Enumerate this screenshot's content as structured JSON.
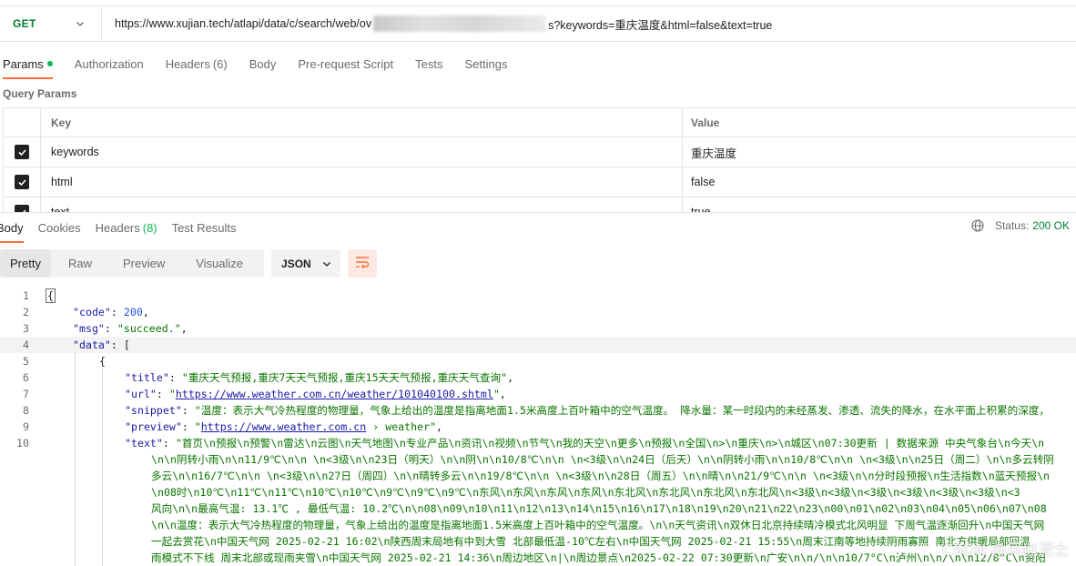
{
  "request": {
    "method": "GET",
    "url_prefix": "https://www.xujian.tech/atlapi/data/c/search/web/ov",
    "url_suffix": "s?keywords=重庆温度&html=false&text=true"
  },
  "request_tabs": [
    {
      "label": "Params",
      "count": "",
      "active": true
    },
    {
      "label": "Authorization",
      "count": ""
    },
    {
      "label": "Headers",
      "count": "(6)"
    },
    {
      "label": "Body",
      "count": ""
    },
    {
      "label": "Pre-request Script",
      "count": ""
    },
    {
      "label": "Tests",
      "count": ""
    },
    {
      "label": "Settings",
      "count": ""
    }
  ],
  "query_params": {
    "title": "Query Params",
    "header_key": "Key",
    "header_value": "Value",
    "rows": [
      {
        "key": "keywords",
        "value": "重庆温度",
        "checked": true
      },
      {
        "key": "html",
        "value": "false",
        "checked": true
      },
      {
        "key": "text",
        "value": "true",
        "checked": true
      }
    ]
  },
  "response_tabs": [
    {
      "label": "Body",
      "count": "",
      "active": true
    },
    {
      "label": "Cookies",
      "count": ""
    },
    {
      "label": "Headers",
      "count": "(8)"
    },
    {
      "label": "Test Results",
      "count": ""
    }
  ],
  "status": {
    "label": "Status:",
    "value": "200 OK"
  },
  "view_modes": [
    "Pretty",
    "Raw",
    "Preview",
    "Visualize"
  ],
  "format": "JSON",
  "code": {
    "line_numbers": [
      "1",
      "2",
      "3",
      "4",
      "5",
      "6",
      "7",
      "8",
      "9",
      "10"
    ],
    "l1": "{",
    "code_key": "\"code\"",
    "code_val": "200",
    "msg_key": "\"msg\"",
    "msg_val": "\"succeed.\"",
    "data_key": "\"data\"",
    "data_open": "[",
    "obj_open": "{",
    "title_key": "\"title\"",
    "title_val": "\"重庆天气预报,重庆7天天气预报,重庆15天天气预报,重庆天气查询\"",
    "url_key": "\"url\"",
    "url_val": "https://www.weather.com.cn/weather/101040100.shtml",
    "snippet_key": "\"snippet\"",
    "snippet_val": "\"温度：表示大气冷热程度的物理量，气象上给出的温度是指离地面1.5米高度上百叶箱中的空气温度。 降水量：某一时段内的未经蒸发、渗透、流失的降水，在水平面上积累的深度，",
    "preview_key": "\"preview\"",
    "preview_link": "https://www.weather.com.cn",
    "preview_rest": " › weather\"",
    "text_key": "\"text\"",
    "text_lines": [
      "\"首页\\n预报\\n预警\\n雷达\\n云图\\n天气地图\\n专业产品\\n资讯\\n视频\\n节气\\n我的天空\\n更多\\n预报\\n全国\\n>\\n重庆\\n>\\n城区\\n07:30更新 | 数据来源 中央气象台\\n今天\\n",
      "\\n\\n阴转小雨\\n\\n11/9℃\\n\\n \\n<3级\\n\\n23日（明天）\\n\\n阴\\n\\n10/8℃\\n\\n \\n<3级\\n\\n24日（后天）\\n\\n阴转小雨\\n\\n10/8℃\\n\\n \\n<3级\\n\\n25日（周二）\\n\\n多云转阴",
      "多云\\n\\n16/7℃\\n\\n \\n<3级\\n\\n27日（周四）\\n\\n晴转多云\\n\\n19/8℃\\n\\n \\n<3级\\n\\n28日（周五）\\n\\n晴\\n\\n21/9℃\\n\\n \\n<3级\\n\\n分时段预报\\n生活指数\\n蓝天预报\\n",
      "\\n08时\\n10℃\\n11℃\\n11℃\\n10℃\\n10℃\\n9℃\\n9℃\\n9℃\\n东风\\n东风\\n东风\\n东风\\n东北风\\n东北风\\n东北风\\n东北风\\n<3级\\n<3级\\n<3级\\n<3级\\n<3级\\n<3级\\n<3",
      "风向\\n\\n最高气温: 13.1℃ , 最低气温: 10.2℃\\n\\n08\\n09\\n10\\n11\\n12\\n13\\n14\\n15\\n16\\n17\\n18\\n19\\n20\\n21\\n22\\n23\\n00\\n01\\n02\\n03\\n04\\n05\\n06\\n07\\n08",
      "\\n\\n温度：表示大气冷热程度的物理量，气象上给出的温度是指离地面1.5米高度上百叶箱中的空气温度。\\n\\n天气资讯\\n双休日北京持续晴冷模式北风明显 下周气温逐渐回升\\n中国天气网",
      "一起去赏花\\n中国天气网 2025-02-21 16:02\\n陕西周末局地有中到大雪 北部最低温-10℃左右\\n中国天气网 2025-02-21 15:55\\n周末江南等地持续阴雨寡照 南北方供暖局部回温",
      "雨模式不下线 周末北部或现雨夹雪\\n中国天气网 2025-02-21 14:36\\n周边地区\\n|\\n周边景点\\n2025-02-22 07:30更新\\n广安\\n\\n/\\n\\n10/7°C\\n泸州\\n\\n/\\n\\n12/8°C\\n资阳"
    ]
  },
  "watermark": "CSDN @风似泥士"
}
